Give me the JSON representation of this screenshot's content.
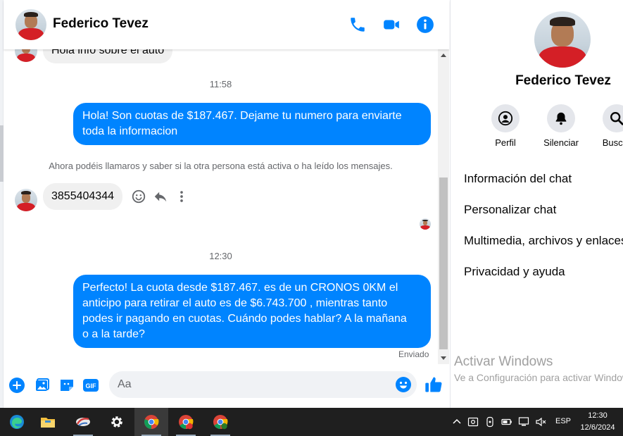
{
  "chat": {
    "contact_name": "Federico Tevez",
    "partial_message": "Hola info sobre el auto",
    "messages": [
      {
        "type": "timestamp",
        "text": "11:58"
      },
      {
        "type": "outgoing",
        "lines": [
          "Hola! Son cuotas de $187.467. Dejame tu numero para enviarte",
          "toda la informacion"
        ]
      },
      {
        "type": "notice",
        "text": "Ahora podéis llamaros y saber si la otra persona está activa o ha leído los mensajes."
      },
      {
        "type": "incoming",
        "text": "3855404344"
      },
      {
        "type": "timestamp",
        "text": "12:30"
      },
      {
        "type": "outgoing",
        "lines": [
          "Perfecto! La cuota desde $187.467. es de un CRONOS 0KM el",
          "anticipo para retirar el auto es de $6.743.700 , mientras tanto",
          "podes ir pagando en cuotas. Cuándo podes hablar? A la mañana",
          "o a la tarde?"
        ]
      }
    ],
    "status": "Enviado",
    "composer_placeholder": "Aa"
  },
  "info": {
    "name": "Federico Tevez",
    "actions": [
      {
        "label": "Perfil",
        "icon": "profile-icon"
      },
      {
        "label": "Silenciar",
        "icon": "bell-icon"
      },
      {
        "label": "Buscar",
        "icon": "search-icon"
      }
    ],
    "menu": [
      "Información del chat",
      "Personalizar chat",
      "Multimedia, archivos y enlaces",
      "Privacidad y ayuda"
    ],
    "watermark_title": "Activar Windows",
    "watermark_sub": "Ve a Configuración para activar Windows."
  },
  "taskbar": {
    "lang": "ESP",
    "time": "12:30",
    "date": "12/6/2024"
  },
  "colors": {
    "accent": "#0084ff",
    "incoming_bubble": "#f0f0f0",
    "taskbar": "#1f1f1f"
  }
}
